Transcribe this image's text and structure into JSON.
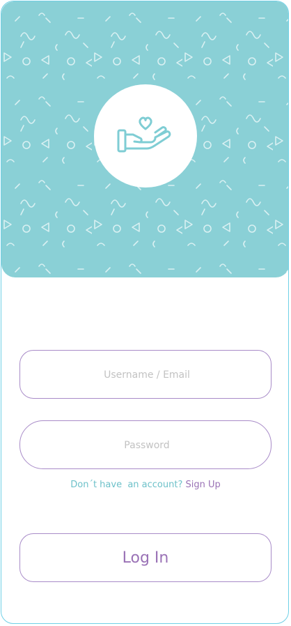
{
  "colors": {
    "hero_background": "#8ad0d6",
    "pattern": "#d9f0f2",
    "icon_stroke": "#7fcdd4",
    "field_border": "#a88bc8",
    "accent_purple": "#9a72b6",
    "accent_teal": "#6dc1c9",
    "card_border": "#6fd0e6"
  },
  "hero": {
    "icon": "hand-holding-heart-icon"
  },
  "form": {
    "username_placeholder": "Username / Email",
    "password_placeholder": "Password"
  },
  "signup": {
    "prompt": "Don´t have  an account?",
    "link": "Sign Up"
  },
  "login_button_label": "Log In"
}
